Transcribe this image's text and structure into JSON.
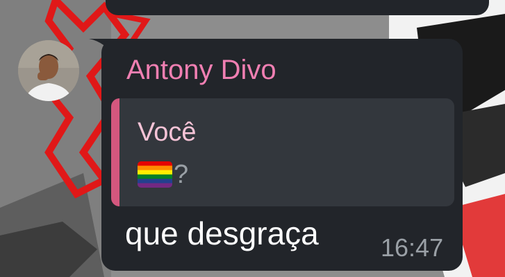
{
  "message": {
    "sender_name": "Antony Divo",
    "reply": {
      "author": "Você",
      "flag_icon": "rainbow-flag-icon",
      "text_suffix": "?"
    },
    "text": "que desgraça",
    "time": "16:47"
  },
  "colors": {
    "bubble_background": "#22252a",
    "quote_background": "#33373d",
    "quote_accent": "#d4577e",
    "sender_name": "#f07fb2",
    "reply_author": "#f5c3d6",
    "message_text": "#ffffff",
    "timestamp": "#9aa0a6"
  }
}
